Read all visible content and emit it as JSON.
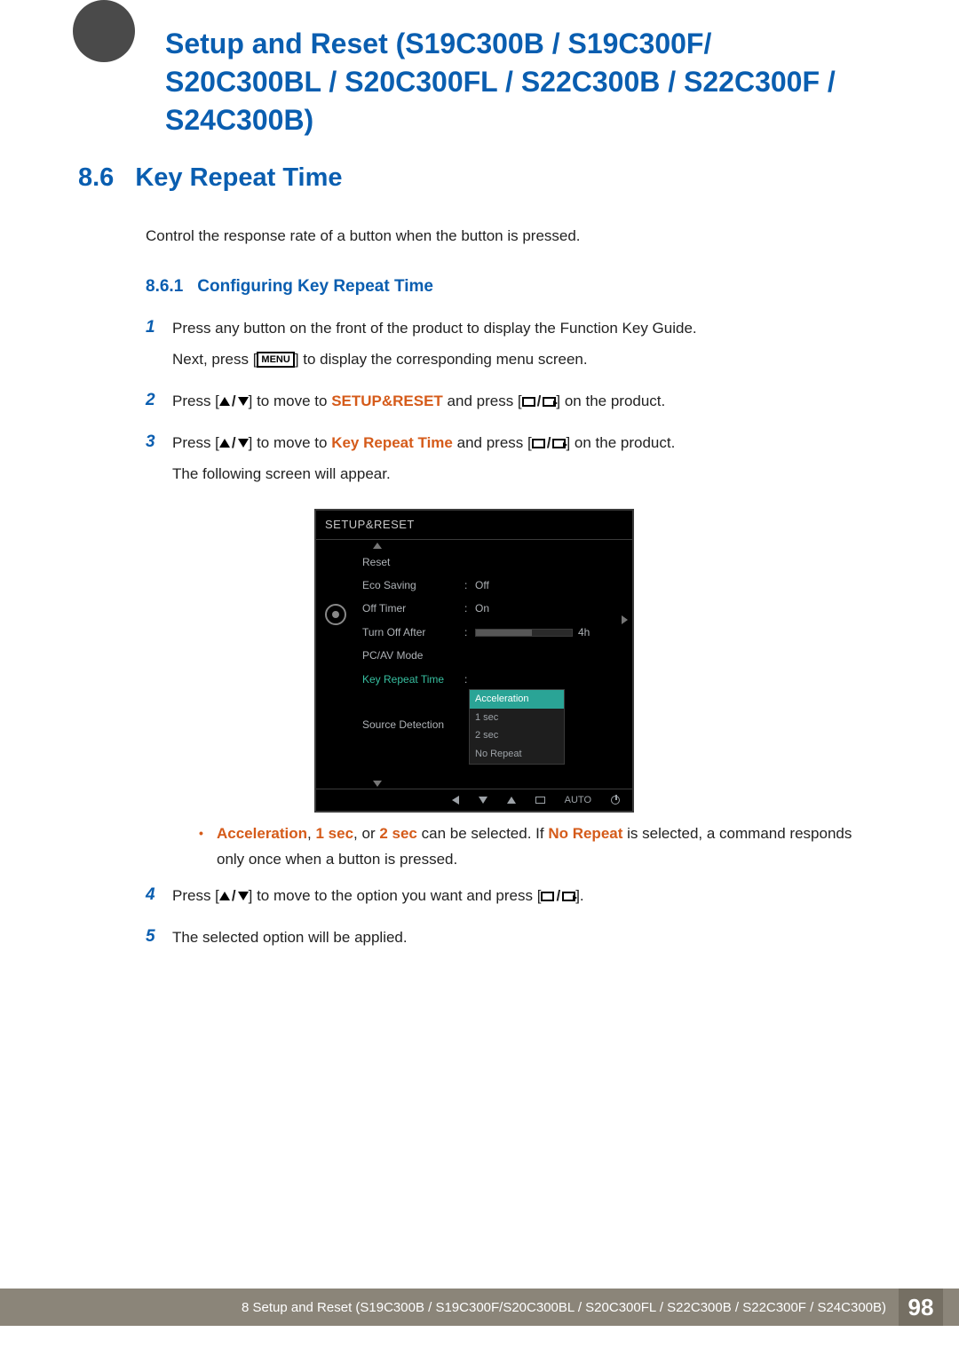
{
  "page_title": "Setup and Reset (S19C300B / S19C300F/ S20C300BL / S20C300FL / S22C300B / S22C300F / S24C300B)",
  "section": {
    "num": "8.6",
    "title": "Key Repeat Time"
  },
  "intro": "Control the response rate of a button when the button is pressed.",
  "subsection": {
    "num": "8.6.1",
    "title": "Configuring Key Repeat Time"
  },
  "steps": {
    "s1a": "Press any button on the front of the product to display the Function Key Guide.",
    "s1b_pre": "Next, press [",
    "s1b_menu": "MENU",
    "s1b_post": "] to display the corresponding menu screen.",
    "s2_pre": "Press [",
    "s2_mid1": "] to move to ",
    "s2_bold": "SETUP&RESET",
    "s2_mid2": " and press [",
    "s2_post": "] on the product.",
    "s3_pre": "Press [",
    "s3_mid1": "] to move to ",
    "s3_bold": "Key Repeat Time",
    "s3_mid2": " and press [",
    "s3_post": "] on the product.",
    "s3_tail": "The following screen will appear.",
    "bullet_acc": "Acceleration",
    "bullet_1s": "1 sec",
    "bullet_or": ", or ",
    "bullet_2s": "2 sec",
    "bullet_mid": " can be selected. If ",
    "bullet_nr": "No Repeat",
    "bullet_tail": " is selected, a command responds only once when a button is pressed.",
    "s4_pre": "Press [",
    "s4_mid1": "] to move to the option you want and press [",
    "s4_post": "].",
    "s5": "The selected option will be applied."
  },
  "osd": {
    "title": "SETUP&RESET",
    "rows": {
      "reset": "Reset",
      "eco": "Eco Saving",
      "eco_val": "Off",
      "offtimer": "Off Timer",
      "offtimer_val": "On",
      "turnoff": "Turn Off After",
      "turnoff_val": "4h",
      "pcav": "PC/AV Mode",
      "krt": "Key Repeat Time",
      "src": "Source Detection"
    },
    "popup": [
      "Acceleration",
      "1 sec",
      "2 sec",
      "No Repeat"
    ],
    "nav_auto": "AUTO"
  },
  "footer": {
    "text": "8 Setup and Reset (S19C300B / S19C300F/S20C300BL / S20C300FL / S22C300B / S22C300F / S24C300B)",
    "page": "98"
  }
}
